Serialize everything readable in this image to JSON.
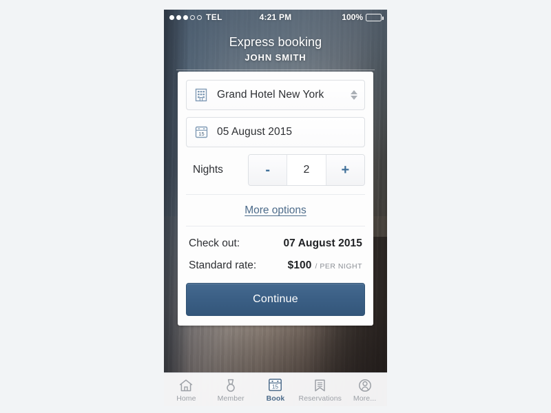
{
  "status_bar": {
    "signal_dots_filled": 3,
    "signal_dots_total": 5,
    "carrier": "TEL",
    "time": "4:21 PM",
    "battery_percent": "100%"
  },
  "header": {
    "title": "Express booking",
    "subtitle": "JOHN SMITH"
  },
  "card": {
    "hotel_field": {
      "icon": "building-icon",
      "value": "Grand Hotel New York"
    },
    "date_field": {
      "icon": "calendar-icon",
      "calendar_day": "15",
      "value": "05 August 2015"
    },
    "nights": {
      "label": "Nights",
      "decrement_label": "-",
      "value": "2",
      "increment_label": "+"
    },
    "more_options_label": "More options",
    "checkout": {
      "label": "Check out:",
      "value": "07 August 2015"
    },
    "rate": {
      "label": "Standard rate:",
      "value": "$100",
      "unit": "/ PER NIGHT"
    },
    "continue_label": "Continue"
  },
  "tab_bar": {
    "items": [
      {
        "id": "home",
        "label": "Home",
        "icon": "home-icon",
        "active": false
      },
      {
        "id": "member",
        "label": "Member",
        "icon": "medal-icon",
        "active": false
      },
      {
        "id": "book",
        "label": "Book",
        "icon": "calendar-icon",
        "calendar_day": "15",
        "active": true
      },
      {
        "id": "reservations",
        "label": "Reservations",
        "icon": "bookmark-icon",
        "active": false
      },
      {
        "id": "more",
        "label": "More...",
        "icon": "person-icon",
        "active": false
      }
    ]
  },
  "colors": {
    "accent_blue": "#4c6b8a",
    "stepper_blue": "#3f6f99",
    "button_blue": "#3b5f85",
    "page_background": "#f2f4f6",
    "muted_gray": "#9ca0a6"
  }
}
